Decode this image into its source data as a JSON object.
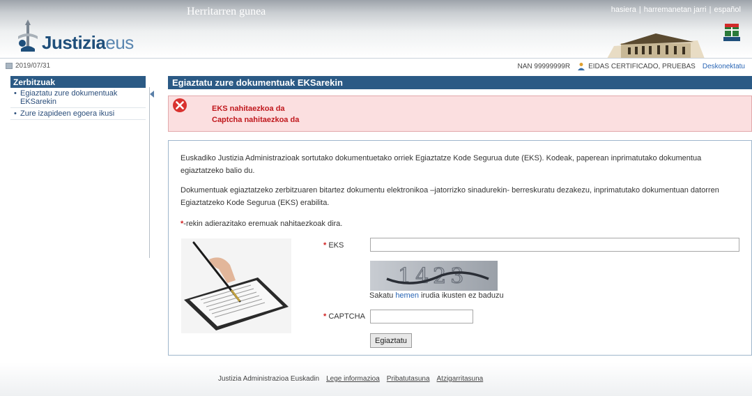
{
  "header": {
    "title": "Herritarren gunea",
    "logo_main": "Justizia",
    "logo_suffix": "eus",
    "links": [
      "hasiera",
      "harremanetan jarri",
      "español"
    ]
  },
  "datebar": {
    "date": "2019/07/31",
    "user_id": "NAN 99999999R",
    "user_name": "EIDAS CERTIFICADO, PRUEBAS",
    "logout": "Deskonektatu"
  },
  "sidebar": {
    "heading": "Zerbitzuak",
    "items": [
      {
        "label": "Egiaztatu zure dokumentuak EKSarekin"
      },
      {
        "label": "Zure izapideen egoera ikusi"
      }
    ]
  },
  "main": {
    "title": "Egiaztatu zure dokumentuak EKSarekin",
    "errors": [
      "EKS nahitaezkoa da",
      "Captcha nahitaezkoa da"
    ],
    "para1": "Euskadiko Justizia Administrazioak sortutako dokumentuetako orriek Egiaztatze Kode Segurua dute (EKS). Kodeak, paperean inprimatutako dokumentua egiaztatzeko balio du.",
    "para2": "Dokumentuak egiaztatzeko zerbitzuaren bitartez dokumentu elektronikoa –jatorrizko sinadurekin- berreskuratu dezakezu, inprimatutako dokumentuan datorren Egiaztatzeko Kode Segurua (EKS) erabilita.",
    "required_marker": "*",
    "required_note": "-rekin adierazitako eremuak nahitaezkoak dira.",
    "eks_label": "EKS",
    "eks_value": "",
    "captcha_text": "1423",
    "hint_before": "Sakatu ",
    "hint_link": "hemen",
    "hint_after": " irudia ikusten ez baduzu",
    "captcha_label": "CAPTCHA",
    "captcha_value": "",
    "submit": "Egiaztatu"
  },
  "footer": {
    "copyright": "Justizia Administrazioa Euskadin",
    "links": [
      "Lege informazioa",
      "Pribatutasuna",
      "Atzigarritasuna"
    ]
  }
}
